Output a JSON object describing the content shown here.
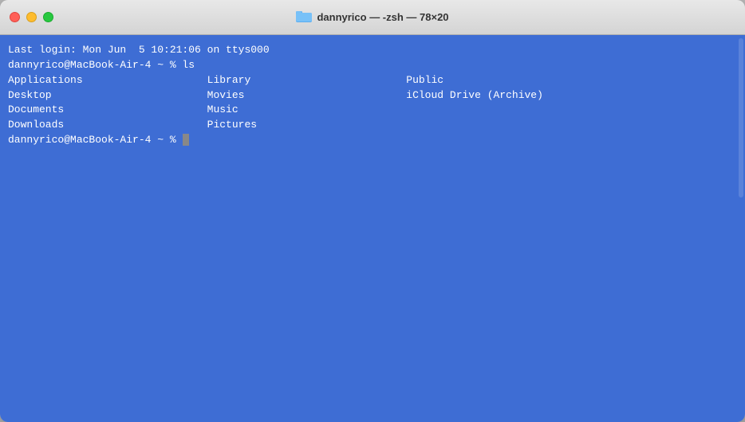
{
  "window": {
    "title": "dannyrico — -zsh — 78×20",
    "bg_color": "#3e6dd4"
  },
  "titlebar": {
    "title": "dannyrico — -zsh — 78×20",
    "traffic_lights": {
      "close_label": "close",
      "minimize_label": "minimize",
      "maximize_label": "maximize"
    }
  },
  "terminal": {
    "line1": "Last login: Mon Jun  5 10:21:06 on ttys000",
    "line2": "dannyrico@MacBook-Air-4 ~ % ls",
    "col1_items": [
      "Applications",
      "Desktop",
      "Documents",
      "Downloads"
    ],
    "col2_items": [
      "Library",
      "Movies",
      "Music",
      "Pictures"
    ],
    "col3_items": [
      "Public",
      "iCloud Drive (Archive)"
    ],
    "prompt": "dannyrico@MacBook-Air-4 ~ % "
  }
}
